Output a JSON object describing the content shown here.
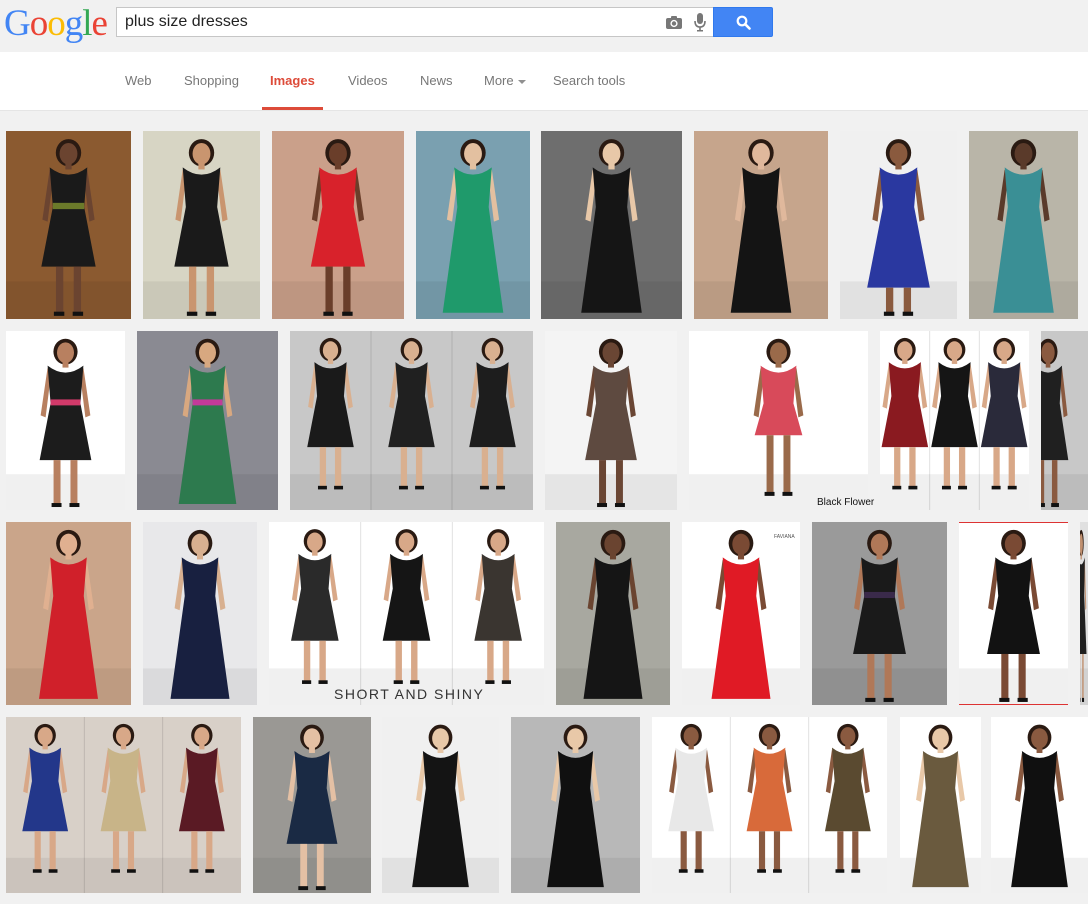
{
  "logo": {
    "letters": [
      "G",
      "o",
      "o",
      "g",
      "l",
      "e"
    ],
    "colors": [
      "#4285f4",
      "#ea4335",
      "#fbbc05",
      "#4285f4",
      "#34a853",
      "#ea4335"
    ]
  },
  "search": {
    "query": "plus size dresses",
    "camera_icon": "camera-icon",
    "mic_icon": "microphone-icon",
    "button_icon": "search-icon",
    "button_color": "#4285f4"
  },
  "tabs": [
    {
      "label": "Web",
      "active": false
    },
    {
      "label": "Shopping",
      "active": false
    },
    {
      "label": "Images",
      "active": true
    },
    {
      "label": "Videos",
      "active": false
    },
    {
      "label": "News",
      "active": false
    },
    {
      "label": "More",
      "active": false,
      "dropdown": true
    },
    {
      "label": "Search tools",
      "active": false
    }
  ],
  "accent_color": "#dd4b39",
  "images": {
    "captions": {
      "black_flower": "Black Flower",
      "short_and_shiny": "SHORT AND SHINY",
      "logo_mark": "FAVIANA"
    },
    "rows": [
      [
        {
          "bg": "#8b5a30",
          "dress": "#1a1a1a",
          "accent": "#6b7a2a",
          "skin": "#6b4430",
          "style": "knee"
        },
        {
          "bg": "#d7d5c4",
          "dress": "#1a1a1a",
          "skin": "#c9956f",
          "style": "knee"
        },
        {
          "bg": "#caa08a",
          "dress": "#d8222b",
          "skin": "#6a3e2a",
          "style": "knee"
        },
        {
          "bg": "#7aa0b0",
          "dress": "#1f9a6b",
          "skin": "#e3c0a0",
          "style": "long"
        },
        {
          "bg": "#6e6e6e",
          "dress": "#151515",
          "skin": "#e8c8a8",
          "style": "long"
        },
        {
          "bg": "#c6a58c",
          "dress": "#141414",
          "skin": "#e0b89c",
          "style": "long"
        },
        {
          "bg": "#f0f0f0",
          "dress": "#2a38a0",
          "skin": "#8a5a3e",
          "style": "hilo"
        },
        {
          "bg": "#b9b5a8",
          "dress": "#3a8f95",
          "skin": "#5a3a2a",
          "style": "long"
        }
      ],
      [
        {
          "bg": "#ffffff",
          "dress": "#1c1c1c",
          "accent": "#d23a6a",
          "skin": "#b88060",
          "style": "knee"
        },
        {
          "bg": "#8a8a92",
          "dress": "#2d7a4e",
          "accent": "#c23a9a",
          "skin": "#d8a880",
          "style": "long"
        },
        {
          "bg": "#c8c8c8",
          "dress": "#181818",
          "skin": "#d9b090",
          "style": "triple"
        },
        {
          "bg": "#f4f4f4",
          "dress": "#5e4a40",
          "skin": "#6a4634",
          "style": "knee"
        },
        {
          "bg": "#ffffff",
          "dress": "#d84a5a",
          "skin": "#9a6a4a",
          "style": "mini"
        },
        {
          "bg": "#ffffff",
          "dress": "#8a1a20",
          "skin": "#d8a888",
          "style": "triple"
        },
        {
          "bg": "#c8c8c8",
          "dress": "#202020",
          "skin": "#8a5a40",
          "style": "partial"
        }
      ],
      [
        {
          "bg": "#caa58a",
          "dress": "#d0202a",
          "skin": "#e0b090",
          "style": "long"
        },
        {
          "bg": "#e8e8ea",
          "dress": "#182040",
          "skin": "#d8b090",
          "style": "long"
        },
        {
          "bg": "#ffffff",
          "dress": "#2a2a2a",
          "skin": "#d8a888",
          "style": "triple"
        },
        {
          "bg": "#a8a8a0",
          "dress": "#151515",
          "skin": "#6a4430",
          "style": "long"
        },
        {
          "bg": "#ffffff",
          "dress": "#e01a25",
          "skin": "#7a4a34",
          "style": "long"
        },
        {
          "bg": "#9a9a9a",
          "dress": "#1a1a1a",
          "accent": "#3a2a4a",
          "skin": "#b07858",
          "style": "knee"
        },
        {
          "bg": "#ffffff",
          "dress": "#121212",
          "skin": "#7a4a34",
          "style": "knee"
        },
        {
          "bg": "#e0e0e0",
          "dress": "#202020",
          "skin": "#c09070",
          "style": "partial"
        }
      ],
      [
        {
          "bg": "#d8d0c8",
          "dress": "#23378a",
          "skin": "#d8a888",
          "style": "triple"
        },
        {
          "bg": "#9a9894",
          "dress": "#1a2a44",
          "skin": "#e4c0a4",
          "style": "knee"
        },
        {
          "bg": "#f0f0f0",
          "dress": "#141414",
          "skin": "#e8c8a8",
          "style": "long"
        },
        {
          "bg": "#b8b8b8",
          "dress": "#101010",
          "skin": "#e8c8a8",
          "style": "long"
        },
        {
          "bg": "#ffffff",
          "dress": "#121212",
          "skin": "#8a5a40",
          "style": "triple"
        },
        {
          "bg": "#ffffff",
          "dress": "#6a5a3e",
          "skin": "#e8c8a8",
          "style": "long"
        },
        {
          "bg": "#ffffff",
          "dress": "#101010",
          "skin": "#8a5a40",
          "style": "long"
        }
      ]
    ]
  }
}
